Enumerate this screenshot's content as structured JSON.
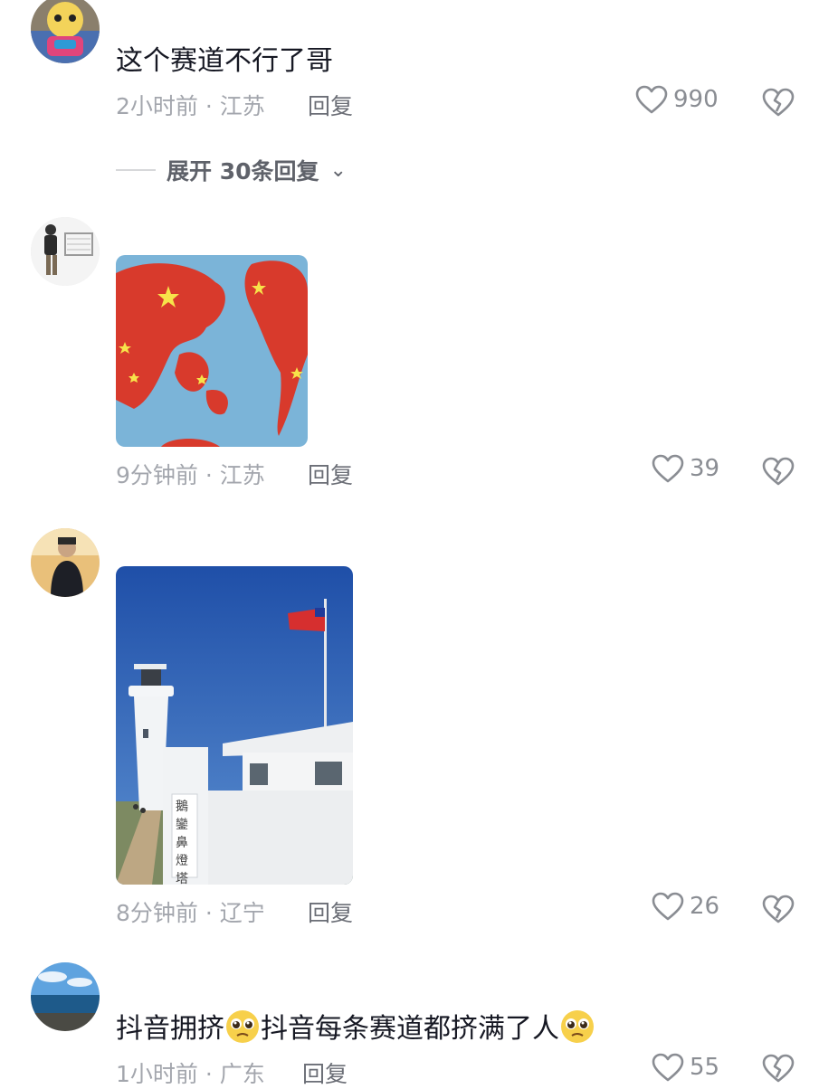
{
  "comments": [
    {
      "text": "这个赛道不行了哥",
      "meta": "2小时前 · 江苏",
      "reply_label": "回复",
      "likes": "990",
      "expand_label": "展开 30条回复",
      "avatar_icon": "cartoon-avatar"
    },
    {
      "meta": "9分钟前 · 江苏",
      "reply_label": "回复",
      "likes": "39",
      "image_icon": "world-map-image",
      "avatar_icon": "person-with-cart-avatar"
    },
    {
      "meta": "8分钟前 · 辽宁",
      "reply_label": "回复",
      "likes": "26",
      "image_icon": "lighthouse-flag-image",
      "image_sign_text": "鵝鑾鼻燈塔",
      "avatar_icon": "man-portrait-avatar"
    },
    {
      "text_part1": "抖音拥挤",
      "text_part2": "抖音每条赛道都挤满了人",
      "meta": "1小时前 · 广东",
      "reply_label": "回复",
      "likes": "55",
      "emoji_icon": "pleading-face-emoji",
      "avatar_icon": "sea-landscape-avatar"
    }
  ],
  "icons": {
    "like": "heart-outline-icon",
    "dislike": "broken-heart-icon",
    "expand": "chevron-down-icon"
  },
  "colors": {
    "text": "#161823",
    "meta": "#a3a6ad",
    "icon": "#8a8d93"
  }
}
